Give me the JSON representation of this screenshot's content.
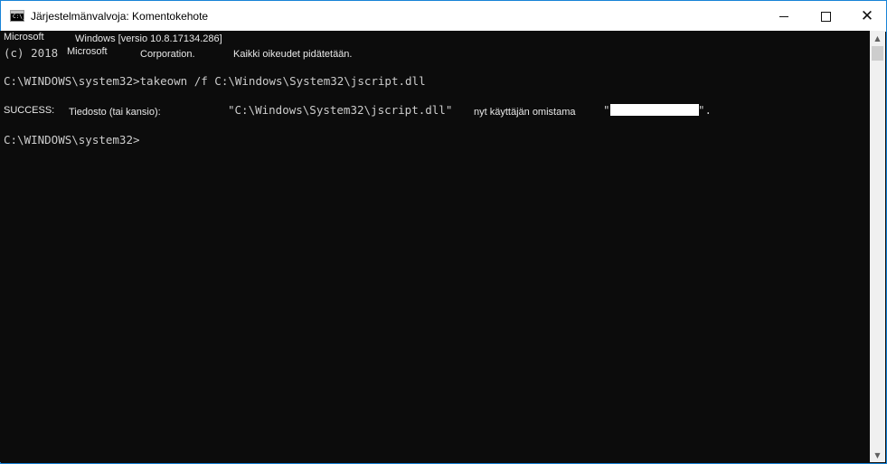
{
  "window": {
    "title": "Järjestelmänvalvoja: Komentokehote",
    "icon_name": "cmd-icon",
    "icon_text": "C:\\_",
    "controls": {
      "minimize": "minimize-icon",
      "maximize": "maximize-icon",
      "close": "close-icon"
    }
  },
  "console": {
    "header": {
      "line1_part1": "Microsoft",
      "line1_part2": "Windows [versio 10.8.17134.286]",
      "line2_copyright": "(c) 2018",
      "line2_part1": "Microsoft",
      "line2_part2": "Corporation.",
      "line2_part3": "Kaikki oikeudet pidätetään."
    },
    "command1": "C:\\WINDOWS\\system32>takeown /f C:\\Windows\\System32\\jscript.dll",
    "result": {
      "status": "SUCCESS:",
      "label": "Tiedosto (tai kansio):",
      "path": "\"C:\\Windows\\System32\\jscript.dll\"",
      "owner_text": "nyt käyttäjän omistama",
      "quote_open": "\"",
      "quote_close": "\"."
    },
    "prompt2": "C:\\WINDOWS\\system32>"
  },
  "scrollbar": {
    "up_arrow": "▲",
    "down_arrow": "▼"
  },
  "colors": {
    "console_bg": "#0c0c0c",
    "console_text": "#cccccc",
    "window_border": "#1883d7"
  }
}
